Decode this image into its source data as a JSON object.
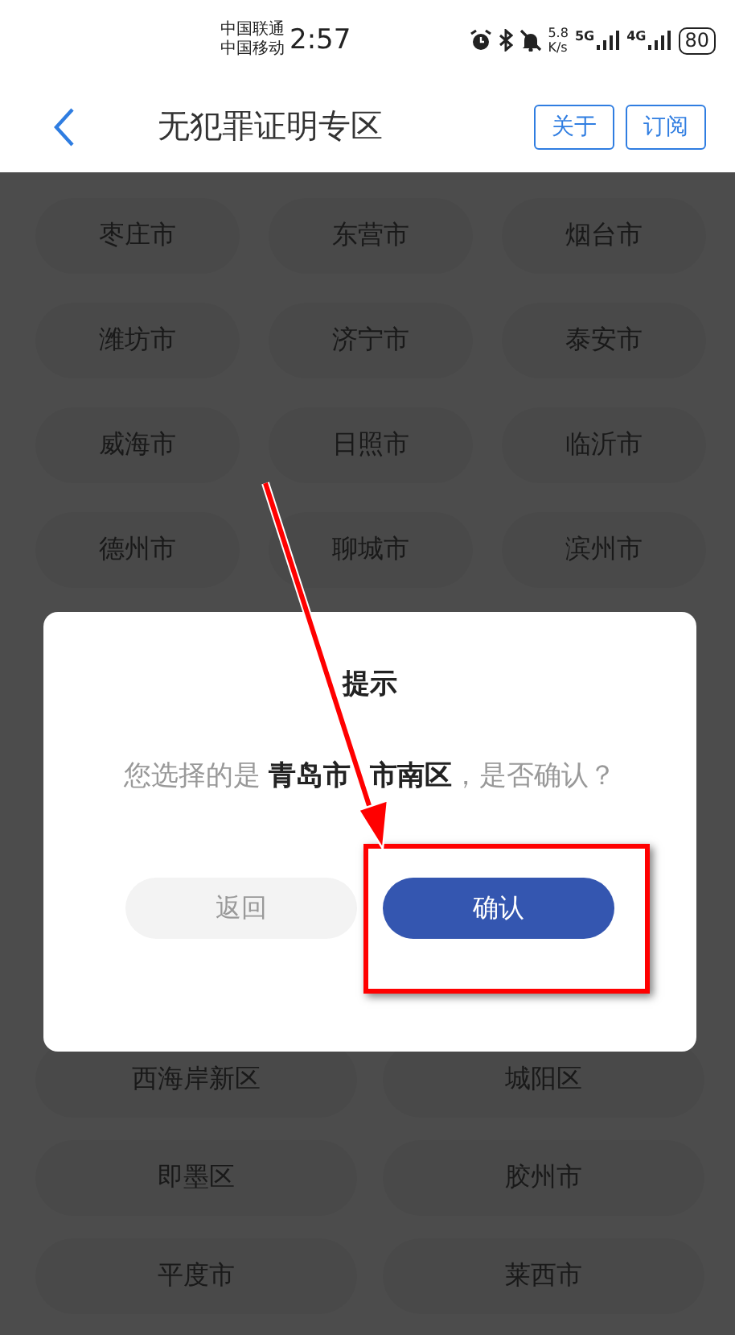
{
  "status_bar": {
    "carriers": [
      "中国联通",
      "中国移动"
    ],
    "time": "2:57",
    "speed_value": "5.8",
    "speed_unit": "K/s",
    "networks": [
      "5G",
      "4G"
    ],
    "battery": "80"
  },
  "nav": {
    "title": "无犯罪证明专区",
    "buttons": [
      "关于",
      "订阅"
    ]
  },
  "cities": [
    "枣庄市",
    "东营市",
    "烟台市",
    "潍坊市",
    "济宁市",
    "泰安市",
    "威海市",
    "日照市",
    "临沂市",
    "德州市",
    "聊城市",
    "滨州市"
  ],
  "districts": [
    "西海岸新区",
    "城阳区",
    "即墨区",
    "胶州市",
    "平度市",
    "莱西市"
  ],
  "dialog": {
    "title": "提示",
    "message": "您选择的是 **青岛市 市南区**，是否确认？",
    "buttons": [
      {
        "label": "返回",
        "kind": "secondary"
      },
      {
        "label": "确认",
        "kind": "primary"
      }
    ]
  }
}
